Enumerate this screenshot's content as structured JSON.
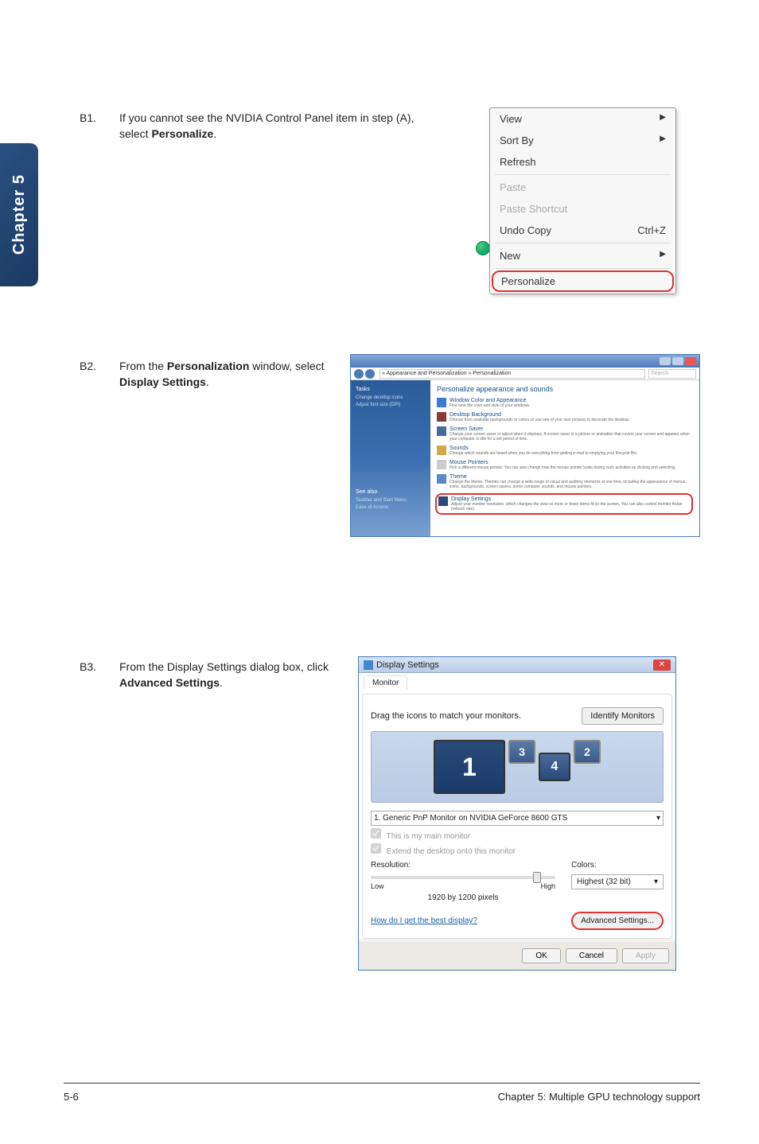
{
  "sidebar_tab": "Chapter 5",
  "steps": {
    "b1": {
      "num": "B1.",
      "text_pre": "If you cannot see the NVIDIA Control Panel item in step (A), select ",
      "text_bold": "Personalize",
      "text_post": "."
    },
    "b2": {
      "num": "B2.",
      "text_pre": "From the ",
      "text_bold1": "Personalization",
      "text_mid": " window, select ",
      "text_bold2": "Display Settings",
      "text_post": "."
    },
    "b3": {
      "num": "B3.",
      "text_pre": "From the Display Settings dialog box, click ",
      "text_bold": "Advanced Settings",
      "text_post": "."
    }
  },
  "context_menu": {
    "view": "View",
    "sort_by": "Sort By",
    "refresh": "Refresh",
    "paste": "Paste",
    "paste_shortcut": "Paste Shortcut",
    "undo_copy": "Undo Copy",
    "undo_shortcut": "Ctrl+Z",
    "new": "New",
    "personalize": "Personalize"
  },
  "personalization": {
    "breadcrumb": "« Appearance and Personalization » Personalization",
    "search_placeholder": "Search",
    "tasks_title": "Tasks",
    "task1": "Change desktop icons",
    "task2": "Adjust font size (DPI)",
    "main_title": "Personalize appearance and sounds",
    "items": [
      {
        "title": "Window Color and Appearance",
        "desc": "Fine tune the color and style of your windows."
      },
      {
        "title": "Desktop Background",
        "desc": "Choose from available backgrounds or colors or use one of your own pictures to decorate the desktop."
      },
      {
        "title": "Screen Saver",
        "desc": "Change your screen saver or adjust when it displays. A screen saver is a picture or animation that covers your screen and appears when your computer is idle for a set period of time."
      },
      {
        "title": "Sounds",
        "desc": "Change which sounds are heard when you do everything from getting e-mail to emptying your Recycle Bin."
      },
      {
        "title": "Mouse Pointers",
        "desc": "Pick a different mouse pointer. You can also change how the mouse pointer looks during such activities as clicking and selecting."
      },
      {
        "title": "Theme",
        "desc": "Change the theme. Themes can change a wide range of visual and auditory elements at one time, including the appearance of menus, icons, backgrounds, screen savers, some computer sounds, and mouse pointers."
      },
      {
        "title": "Display Settings",
        "desc": "Adjust your monitor resolution, which changes the view so more or fewer items fit on the screen. You can also control monitor flicker (refresh rate)."
      }
    ],
    "see_also": "See also",
    "see1": "Taskbar and Start Menu",
    "see2": "Ease of Access"
  },
  "display_dialog": {
    "title": "Display Settings",
    "tab": "Monitor",
    "drag_label": "Drag the icons to match your monitors.",
    "identify": "Identify Monitors",
    "monitors": [
      "1",
      "3",
      "4",
      "2"
    ],
    "monitor_select": "1. Generic PnP Monitor on NVIDIA GeForce 8600 GTS",
    "chk_main": "This is my main monitor",
    "chk_extend": "Extend the desktop onto this monitor",
    "resolution_label": "Resolution:",
    "low": "Low",
    "high": "High",
    "res_value": "1920 by 1200 pixels",
    "colors_label": "Colors:",
    "colors_value": "Highest (32 bit)",
    "help_link": "How do I get the best display?",
    "advanced": "Advanced Settings...",
    "ok": "OK",
    "cancel": "Cancel",
    "apply": "Apply"
  },
  "footer": {
    "page": "5-6",
    "chapter": "Chapter 5: Multiple GPU technology support"
  }
}
